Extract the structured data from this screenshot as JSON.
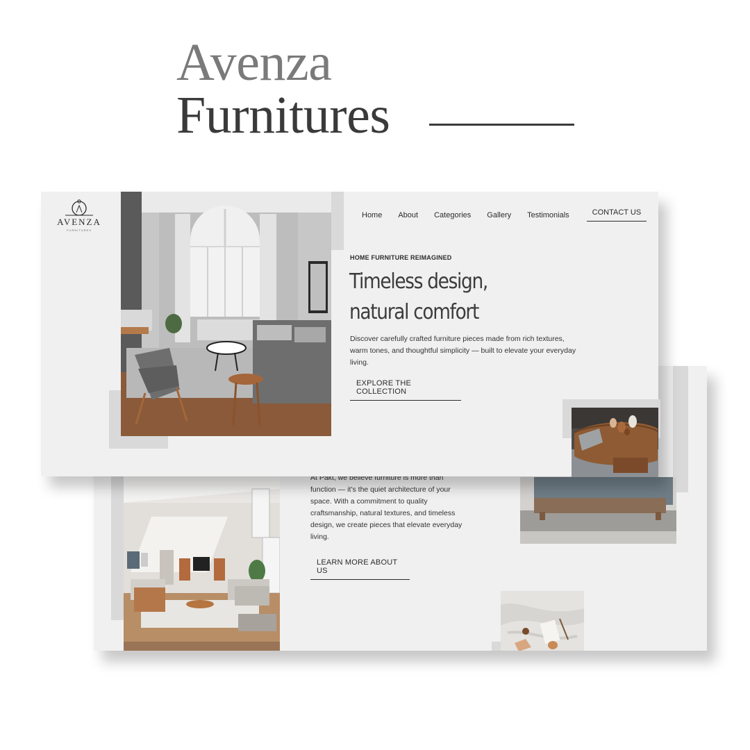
{
  "poster": {
    "title_line1": "Avenza",
    "title_line2": "Furnitures"
  },
  "brand": {
    "logo_word": "AVENZA",
    "logo_sub": "FURNITURES"
  },
  "nav": {
    "items": [
      {
        "label": "Home"
      },
      {
        "label": "About"
      },
      {
        "label": "Categories"
      },
      {
        "label": "Gallery"
      },
      {
        "label": "Testimonials"
      }
    ],
    "contact_label": "CONTACT US"
  },
  "hero": {
    "eyebrow": "HOME FURNITURE REIMAGINED",
    "headline_line1": "Timeless design,",
    "headline_line2": "natural comfort",
    "body": "Discover carefully crafted furniture pieces made from rich textures, warm tones, and thoughtful simplicity — built to elevate your everyday living.",
    "cta_label": "EXPLORE THE COLLECTION"
  },
  "about": {
    "body": "At Pakt, we believe furniture is more than function — it’s the quiet architecture of your space. With a commitment to quality craftsmanship, natural textures, and timeless design, we create pieces that elevate everyday living.",
    "cta_label": "LEARN MORE ABOUT US"
  },
  "colors": {
    "card_bg": "#f0f0f0",
    "accent_block": "#d9d9d9",
    "text_dark": "#2b2b2b",
    "title_gray": "#7a7a7a"
  }
}
